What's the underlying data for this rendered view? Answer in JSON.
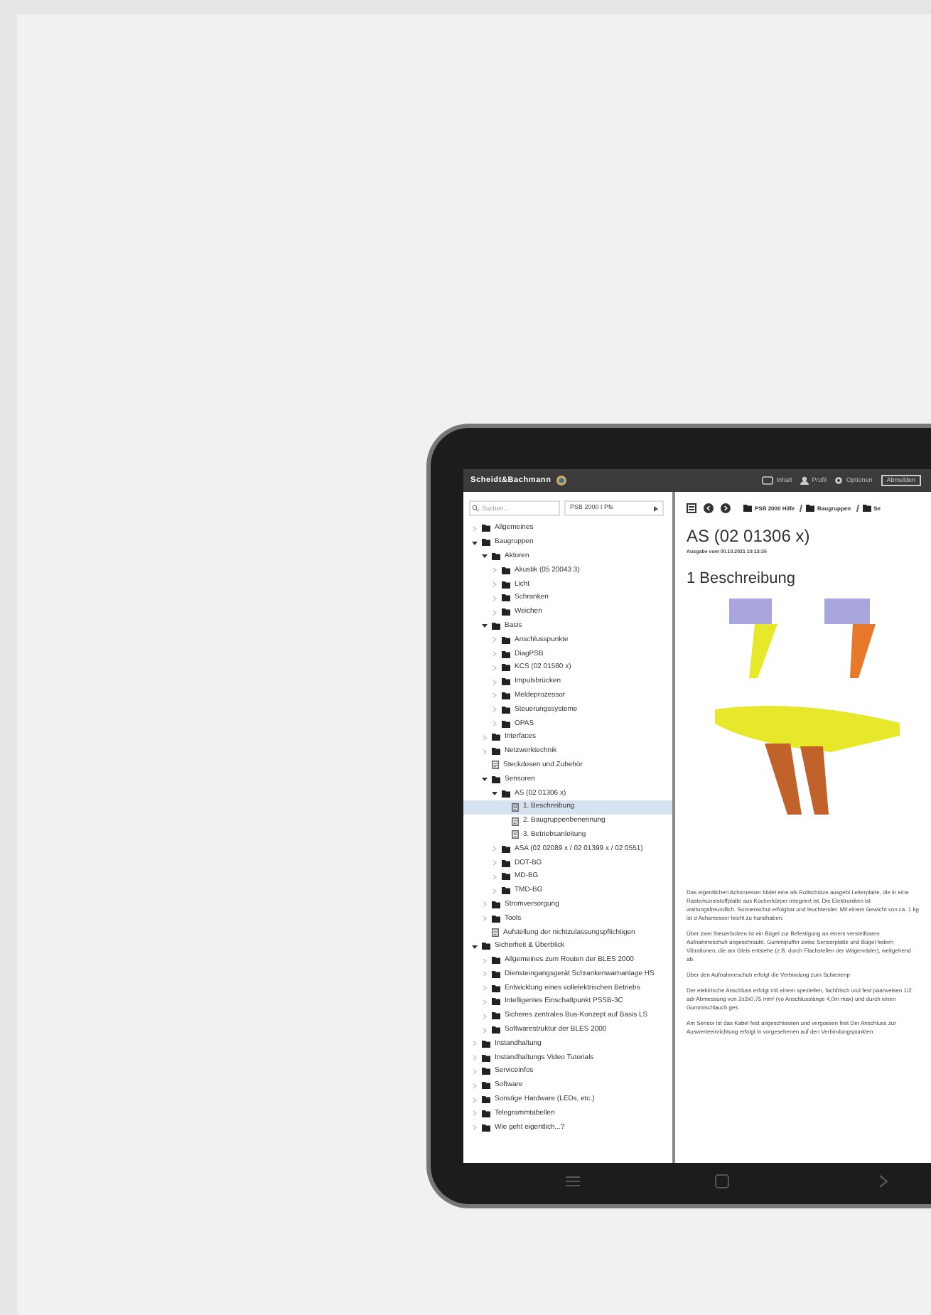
{
  "app_bar": {
    "logo": "Scheidt&Bachmann",
    "menu": [
      {
        "label": "Inhalt",
        "kind": "contents"
      },
      {
        "label": "Profil",
        "kind": "profile"
      },
      {
        "label": "Optionen",
        "kind": "options"
      }
    ],
    "logout": "Abmelden"
  },
  "sidebar": {
    "search": {
      "placeholder": "Suchen..."
    },
    "version_select": "PSB 2000 t Pfe",
    "tree": [
      {
        "label": "Allgemeines",
        "kind": "folder",
        "expanded": false,
        "selected": false
      },
      {
        "label": "Baugruppen",
        "kind": "folder",
        "expanded": true,
        "selected": false,
        "children": [
          {
            "label": "Aktoren",
            "kind": "folder",
            "expanded": true,
            "selected": false,
            "children": [
              {
                "label": "Akustik (05 20043 3)",
                "kind": "folder",
                "expanded": false,
                "selected": false
              },
              {
                "label": "Licht",
                "kind": "folder",
                "expanded": false,
                "selected": false
              },
              {
                "label": "Schranken",
                "kind": "folder",
                "expanded": false,
                "selected": false
              },
              {
                "label": "Weichen",
                "kind": "folder",
                "expanded": false,
                "selected": false
              }
            ]
          },
          {
            "label": "Basis",
            "kind": "folder",
            "expanded": true,
            "selected": false,
            "children": [
              {
                "label": "Anschlusspunkte",
                "kind": "folder",
                "expanded": false,
                "selected": false
              },
              {
                "label": "DiagPSB",
                "kind": "folder",
                "expanded": false,
                "selected": false
              },
              {
                "label": "KCS (02 01580 x)",
                "kind": "folder",
                "expanded": false,
                "selected": false
              },
              {
                "label": "Impulsbrücken",
                "kind": "folder",
                "expanded": false,
                "selected": false
              },
              {
                "label": "Meldeprozessor",
                "kind": "folder",
                "expanded": false,
                "selected": false
              },
              {
                "label": "Steuerungssysteme",
                "kind": "folder",
                "expanded": false,
                "selected": false
              },
              {
                "label": "OPAS",
                "kind": "folder",
                "expanded": false,
                "selected": false
              }
            ]
          },
          {
            "label": "Interfaces",
            "kind": "folder",
            "expanded": false,
            "selected": false
          },
          {
            "label": "Netzwerktechnik",
            "kind": "folder",
            "expanded": false,
            "selected": false
          },
          {
            "label": "Steckdosen und Zubehör",
            "kind": "page",
            "selected": false
          },
          {
            "label": "Sensoren",
            "kind": "folder",
            "expanded": true,
            "selected": false,
            "children": [
              {
                "label": "AS (02 01306 x)",
                "kind": "folder",
                "expanded": true,
                "selected": false,
                "children": [
                  {
                    "label": "1. Beschreibung",
                    "kind": "page",
                    "selected": true
                  },
                  {
                    "label": "2. Baugruppenbenennung",
                    "kind": "page",
                    "selected": false
                  },
                  {
                    "label": "3. Betriebsanleitung",
                    "kind": "page",
                    "selected": false
                  }
                ]
              },
              {
                "label": "ASA (02 02089 x / 02 01399 x / 02 0551)",
                "kind": "folder",
                "expanded": false,
                "selected": false
              },
              {
                "label": "DOT-BG",
                "kind": "folder",
                "expanded": false,
                "selected": false
              },
              {
                "label": "MD-BG",
                "kind": "folder",
                "expanded": false,
                "selected": false
              },
              {
                "label": "TMD-BG",
                "kind": "folder",
                "expanded": false,
                "selected": false
              }
            ]
          },
          {
            "label": "Stromversorgung",
            "kind": "folder",
            "expanded": false,
            "selected": false
          },
          {
            "label": "Tools",
            "kind": "folder",
            "expanded": false,
            "selected": false
          },
          {
            "label": "Aufstellung der nichtzulassungspflichtigen",
            "kind": "page",
            "selected": false
          }
        ]
      },
      {
        "label": "Sicherheit & Überblick",
        "kind": "folder",
        "expanded": true,
        "selected": false,
        "children": [
          {
            "label": "Allgemeines zum Routen der BLES 2000",
            "kind": "folder",
            "expanded": false,
            "selected": false
          },
          {
            "label": "Diensteingangsgerät Schrankenwarnanlage HS",
            "kind": "folder",
            "expanded": false,
            "selected": false
          },
          {
            "label": "Entwicklung eines vollelektrischen Betriebs",
            "kind": "folder",
            "expanded": false,
            "selected": false
          },
          {
            "label": "Intelligentes Einschaltpunkt PSSB-3C",
            "kind": "folder",
            "expanded": false,
            "selected": false
          },
          {
            "label": "Sicheres zentrales Bus-Konzept auf Basis LS",
            "kind": "folder",
            "expanded": false,
            "selected": false
          },
          {
            "label": "Softwarestruktur der BLES 2000",
            "kind": "folder",
            "expanded": false,
            "selected": false
          }
        ]
      },
      {
        "label": "Instandhaltung",
        "kind": "folder",
        "expanded": false,
        "selected": false
      },
      {
        "label": "Instandhaltungs Video Tutorials",
        "kind": "folder",
        "expanded": false,
        "selected": false
      },
      {
        "label": "Serviceinfos",
        "kind": "folder",
        "expanded": false,
        "selected": false
      },
      {
        "label": "Software",
        "kind": "folder",
        "expanded": false,
        "selected": false
      },
      {
        "label": "Sonstige Hardware (LEDs, etc.)",
        "kind": "folder",
        "expanded": false,
        "selected": false
      },
      {
        "label": "Telegrammtabellen",
        "kind": "folder",
        "expanded": false,
        "selected": false
      },
      {
        "label": "Wie geht eigentlich...?",
        "kind": "folder",
        "expanded": false,
        "selected": false
      }
    ]
  },
  "content": {
    "breadcrumb": [
      "PSB 2000 Hilfe",
      "Baugruppen",
      "Se"
    ],
    "title": "AS (02 01306 x)",
    "issued": "Ausgabe vom 00.10.2021 10:13:35",
    "heading": "1 Beschreibung",
    "paragraphs": [
      "Das eigentlichen Achsmesser bildet eine als Rollschütze ausgebi Leiterplatte, die in eine Rasterkunststoffplatte aus Kocherkörper integriert ist. Die Elektroniken ist wartungsfreundlich. Sonnenschut erfolgbar und leuchtender. Mit einem Gewicht von ca. 1 kg ist d Achsmesser leicht zu handhaben.",
      "Über zwei Steuerbolzen ist ein Bügel zur Befestigung an einem verstellbaren Aufnahmeschuh angeschraubt. Gummipuffer zwisc Sensorplatte und Bügel federn Vibrationen, die am Gleis entstehe (z.B. durch Flachstellen der Wagenräder), weitgehend ab.",
      "Über den Aufnahmeschuh erfolgt die Verbindung zum Schienenp",
      "Der elektrische Anschluss erfolgt mit einem speziellen, fachfrisch und fest paarweisen 1/2 adr Abmessung von 2x2x0,75 mm² (vo Anschlusslänge 4,0m max) und durch einen Gummischlauch ges",
      "Am Sensor ist das Kabel fest angeschlossen und vergossen fest Der Anschluss zur Auswerteeinrichtung erfolgt in vorgesehenen auf den Verbindungspunkten"
    ]
  }
}
